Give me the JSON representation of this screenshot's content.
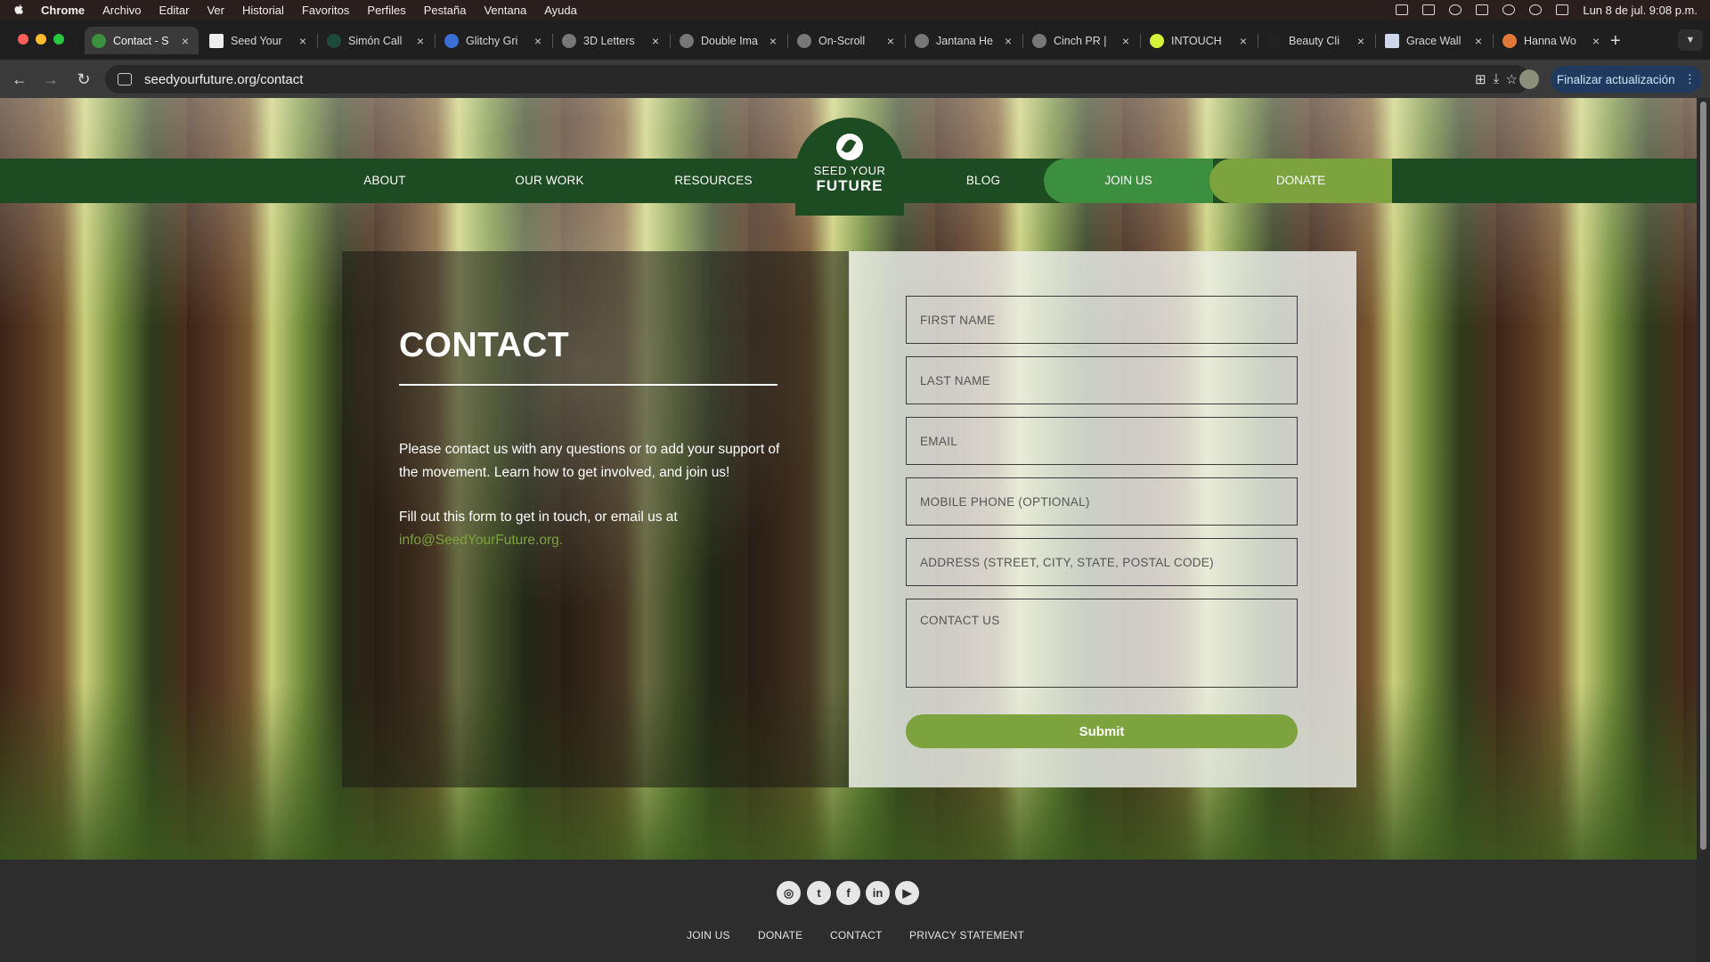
{
  "menubar": {
    "app": "Chrome",
    "items": [
      "Archivo",
      "Editar",
      "Ver",
      "Historial",
      "Favoritos",
      "Perfiles",
      "Pestaña",
      "Ventana",
      "Ayuda"
    ],
    "clock": "Lun 8 de jul.  9:08 p.m."
  },
  "tabs": [
    {
      "title": "Contact - S",
      "active": true
    },
    {
      "title": "Seed Your",
      "active": false
    },
    {
      "title": "Simón Call",
      "active": false
    },
    {
      "title": "Glitchy Gri",
      "active": false
    },
    {
      "title": "3D Letters",
      "active": false
    },
    {
      "title": "Double Ima",
      "active": false
    },
    {
      "title": "On-Scroll",
      "active": false
    },
    {
      "title": "Jantana He",
      "active": false
    },
    {
      "title": "Cinch PR |",
      "active": false
    },
    {
      "title": "INTOUCH",
      "active": false
    },
    {
      "title": "Beauty Cli",
      "active": false
    },
    {
      "title": "Grace Wall",
      "active": false
    },
    {
      "title": "Hanna Wo",
      "active": false
    }
  ],
  "toolbar": {
    "url": "seedyourfuture.org/contact",
    "update_label": "Finalizar actualización"
  },
  "nav": {
    "about": "ABOUT",
    "our_work": "OUR WORK",
    "resources": "RESOURCES",
    "blog": "BLOG",
    "join_us": "JOIN US",
    "donate": "DONATE",
    "logo_top": "SEED YOUR",
    "logo_bottom": "FUTURE"
  },
  "contact": {
    "title": "CONTACT",
    "intro": "Please contact us with any questions or to add your support of the movement. Learn how to get involved, and join us!",
    "fill_text": "Fill out this form to get in touch, or email us at",
    "email": "info@SeedYourFuture.org."
  },
  "form": {
    "first_name_placeholder": "FIRST NAME",
    "last_name_placeholder": "LAST NAME",
    "email_placeholder": "EMAIL",
    "phone_placeholder": "MOBILE PHONE (OPTIONAL)",
    "address_placeholder": "ADDRESS (STREET, CITY, STATE, POSTAL CODE)",
    "message_placeholder": "CONTACT US",
    "submit_label": "Submit"
  },
  "footer": {
    "social": [
      "instagram-icon",
      "twitter-icon",
      "facebook-icon",
      "linkedin-icon",
      "youtube-icon"
    ],
    "links": [
      "JOIN US",
      "DONATE",
      "CONTACT",
      "PRIVACY STATEMENT"
    ]
  },
  "colors": {
    "nav_green": "#1d4b22",
    "join_green": "#3c8f3f",
    "donate_green": "#7ca33e",
    "footer": "#2d2d2d"
  }
}
